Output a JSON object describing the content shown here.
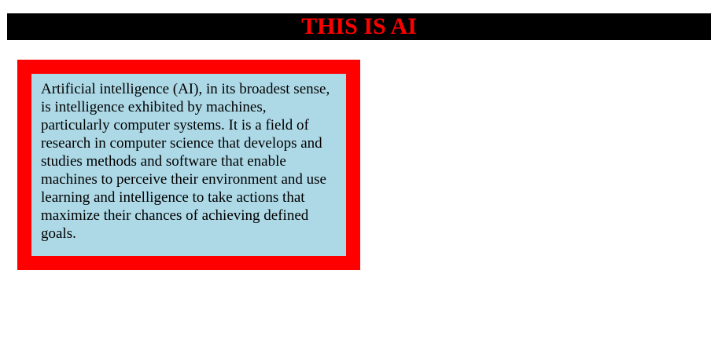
{
  "header": {
    "title": "THIS IS AI"
  },
  "card": {
    "text": "Artificial intelligence (AI), in its broadest sense, is intelligence exhibited by machines, particularly computer systems. It is a field of research in computer science that develops and studies methods and software that enable machines to perceive their environment and use learning and intelligence to take actions that maximize their chances of achieving defined goals."
  },
  "colors": {
    "header_background": "#000000",
    "title_text": "#ff0000",
    "card_border": "#ff0000",
    "card_background": "#add8e6",
    "body_text": "#000000"
  }
}
